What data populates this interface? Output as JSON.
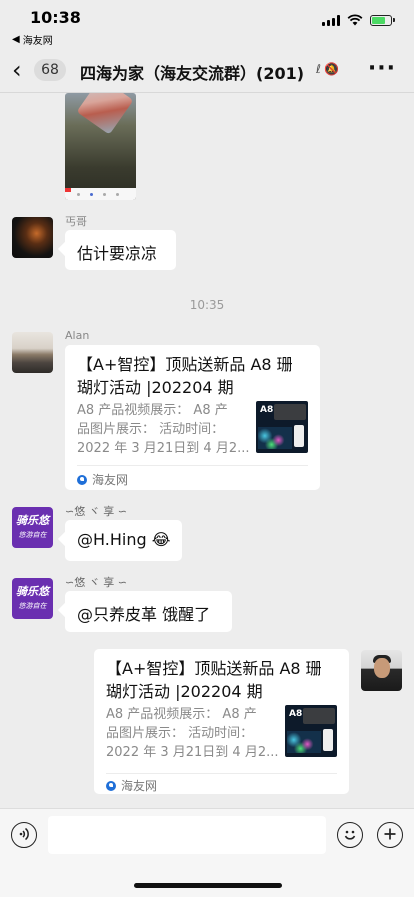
{
  "status_bar": {
    "time": "10:38",
    "back_app_label": "海友网"
  },
  "nav": {
    "badge": "68",
    "title": "四海为家（海友交流群）(201)"
  },
  "time_label": "10:35",
  "messages": [
    {
      "sender": "丐哥",
      "text": "估计要凉凉"
    },
    {
      "sender": "Alan",
      "card": {
        "title_line1": "【A+智控】顶贴送新品 A8 珊",
        "title_line2": "瑚灯活动 |202204 期",
        "desc_line1": "A8 产品视频展示：  A8 产",
        "desc_line2": "品图片展示：  活动时间：",
        "desc_line3": "2022 年 3 月21日到 4 月2...",
        "thumb_tag": "A8",
        "source": "海友网"
      }
    },
    {
      "sender": "∽悠 ヾ 享 ∽",
      "text": "@H.Hing 😂"
    },
    {
      "sender": "∽悠 ヾ 享 ∽",
      "text": "@只养皮革 饿醒了"
    }
  ],
  "avatar_purple_text": {
    "line1": "骑乐悠",
    "line2": "悠游自在"
  },
  "self_card": {
    "title_line1": "【A+智控】顶贴送新品 A8 珊",
    "title_line2": "瑚灯活动 |202204 期",
    "desc_line1": "A8 产品视频展示：  A8 产",
    "desc_line2": "品图片展示：  活动时间：",
    "desc_line3": "2022 年 3 月21日到 4 月2...",
    "thumb_tag": "A8",
    "source": "海友网"
  },
  "input": {
    "placeholder": ""
  }
}
